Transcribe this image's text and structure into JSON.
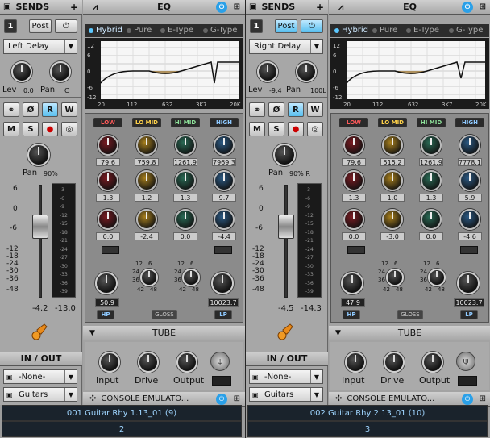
{
  "strips": [
    {
      "sends_title": "SENDS",
      "slot_num": "1",
      "post_label": "Post",
      "send_dest": "Left Delay",
      "lev_label": "Lev",
      "lev_value": "0.0",
      "pan_label": "Pan",
      "pan_value": "C",
      "btns": [
        "Ø",
        "R",
        "W"
      ],
      "btns2": [
        "M",
        "S"
      ],
      "ch_pan_label": "Pan",
      "ch_pan_value": "90%",
      "fader_scale": [
        "6",
        "0",
        "-6",
        "-12",
        "-18",
        "-24",
        "-30",
        "-36",
        "-48"
      ],
      "vol_value": "-4.2",
      "peak_value": "-13.0",
      "io_title": "IN / OUT",
      "input": "-None-",
      "output": "Guitars",
      "eq_title": "EQ",
      "modes": [
        "Hybrid",
        "Pure",
        "E-Type",
        "G-Type"
      ],
      "freq_ticks": [
        "20",
        "112",
        "632",
        "3K7",
        "20K"
      ],
      "db_ticks": [
        "12",
        "6",
        "0",
        "-6",
        "-12"
      ],
      "bands": [
        "LOW",
        "LO MID",
        "HI MID",
        "HIGH"
      ],
      "freq_vals": [
        "79.6",
        "759.8",
        "1261.9",
        "7969.3"
      ],
      "q_vals": [
        "1.3",
        "1.2",
        "1.3",
        "9.7"
      ],
      "gain_vals": [
        "0.0",
        "-2.4",
        "0.0",
        "-4.4"
      ],
      "hp_value": "50.9",
      "lp_value": "10023.7",
      "hp": "HP",
      "lp": "LP",
      "gloss": "GLOSS",
      "slope": [
        "12",
        "6",
        "24",
        "36",
        "42",
        "48"
      ],
      "tube_title": "TUBE",
      "tube_knobs": [
        "Input",
        "Drive",
        "Output"
      ],
      "console": "CONSOLE EMULATO...",
      "track_name": "001 Guitar Rhy 1.13_01 (9)",
      "track_num": "2",
      "post_on": false
    },
    {
      "sends_title": "SENDS",
      "slot_num": "1",
      "post_label": "Post",
      "send_dest": "Right Delay",
      "lev_label": "Lev",
      "lev_value": "-9.4",
      "pan_label": "Pan",
      "pan_value": "100L",
      "btns": [
        "Ø",
        "R",
        "W"
      ],
      "btns2": [
        "M",
        "S"
      ],
      "ch_pan_label": "Pan",
      "ch_pan_value": "90% R",
      "fader_scale": [
        "6",
        "0",
        "-6",
        "-12",
        "-18",
        "-24",
        "-30",
        "-36",
        "-48"
      ],
      "vol_value": "-4.5",
      "peak_value": "-14.3",
      "io_title": "IN / OUT",
      "input": "-None-",
      "output": "Guitars",
      "eq_title": "EQ",
      "modes": [
        "Hybrid",
        "Pure",
        "E-Type",
        "G-Type"
      ],
      "freq_ticks": [
        "20",
        "112",
        "632",
        "3K7",
        "20K"
      ],
      "db_ticks": [
        "12",
        "6",
        "0",
        "-6",
        "-12"
      ],
      "bands": [
        "LOW",
        "LO MID",
        "HI MID",
        "HIGH"
      ],
      "freq_vals": [
        "79.6",
        "515.2",
        "1261.9",
        "7778.1"
      ],
      "q_vals": [
        "1.3",
        "1.0",
        "1.3",
        "5.9"
      ],
      "gain_vals": [
        "0.0",
        "-3.0",
        "0.0",
        "-4.6"
      ],
      "hp_value": "47.9",
      "lp_value": "10023.7",
      "hp": "HP",
      "lp": "LP",
      "gloss": "GLOSS",
      "slope": [
        "12",
        "6",
        "24",
        "36",
        "42",
        "48"
      ],
      "tube_title": "TUBE",
      "tube_knobs": [
        "Input",
        "Drive",
        "Output"
      ],
      "console": "CONSOLE EMULATO...",
      "track_name": "002 Guitar Rhy 2.13_01 (10)",
      "track_num": "3",
      "post_on": true
    }
  ],
  "colors": {
    "low": "#ff5a5a",
    "lomid": "#ffd24a",
    "himid": "#8ee29a",
    "high": "#8ec9ff",
    "accent": "#2aa0e8"
  }
}
